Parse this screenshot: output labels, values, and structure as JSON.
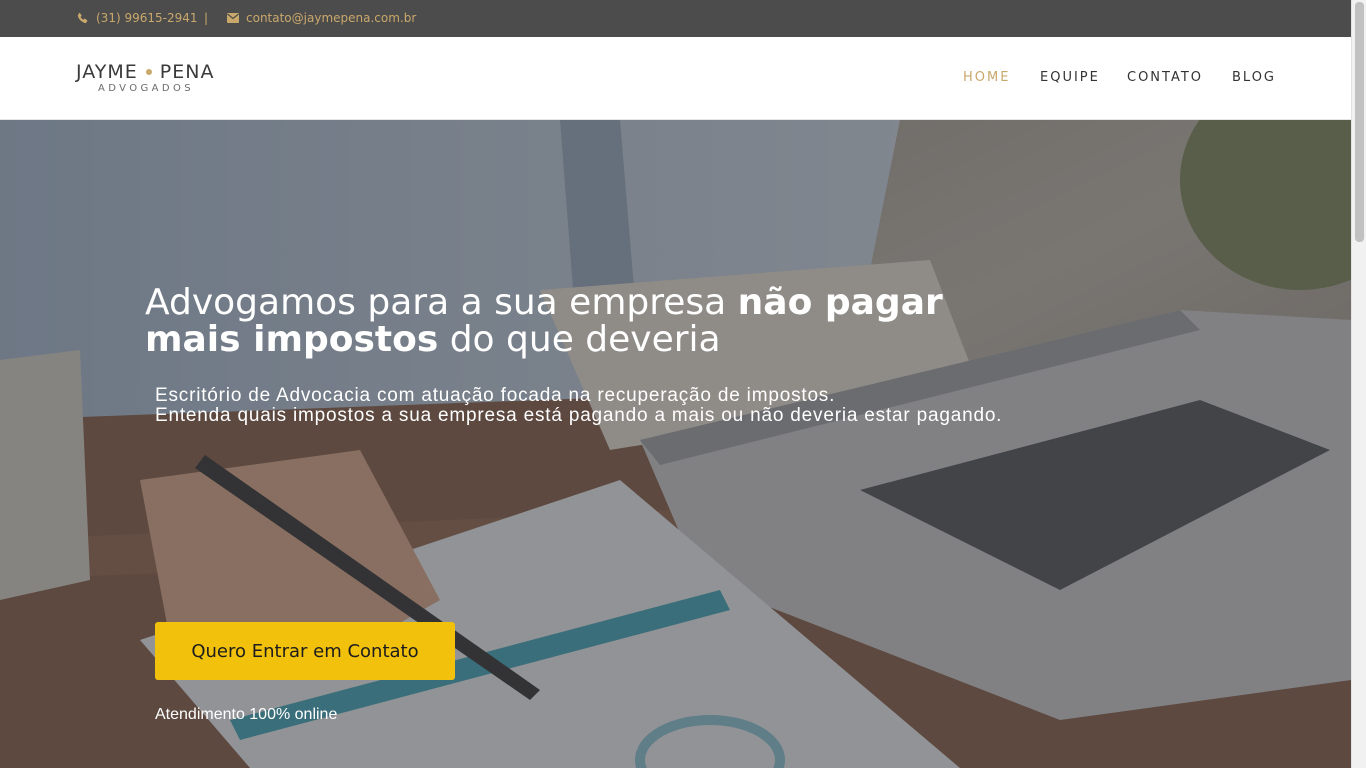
{
  "topbar": {
    "phone": "(31) 99615-2941",
    "separator": "|",
    "email": "contato@jaymepena.com.br",
    "accent_color": "#c9a86b"
  },
  "logo": {
    "word1": "JAYME",
    "word2": "PENA",
    "subtitle": "ADVOGADOS"
  },
  "nav": {
    "items": [
      {
        "label": "HOME",
        "active": true
      },
      {
        "label": "EQUIPE",
        "active": false
      },
      {
        "label": "CONTATO",
        "active": false
      },
      {
        "label": "BLOG",
        "active": false
      }
    ]
  },
  "hero": {
    "headline_part1": "Advogamos para a sua empresa ",
    "headline_bold1": "não pagar",
    "headline_bold2": "mais impostos",
    "headline_part2": " do que deveria",
    "sub_line1": "Escritório de Advocacia com atuação focada na recuperação de impostos.",
    "sub_line2": "Entenda quais impostos a sua empresa está pagando a mais ou não deveria estar pagando.",
    "cta_label": "Quero Entrar em Contato",
    "cta_color": "#f2c10b",
    "online_note": "Atendimento 100% online"
  }
}
